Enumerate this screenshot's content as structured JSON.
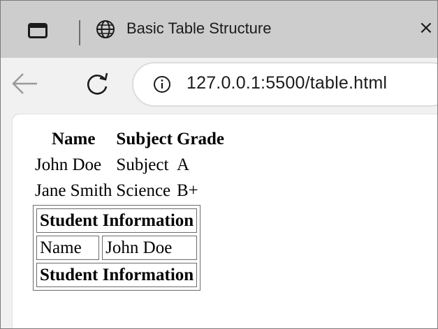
{
  "browser": {
    "tab_title": "Basic Table Structure",
    "tab_close": "×",
    "url": "127.0.0.1:5500/table.html",
    "icons": {
      "tab_actions": "tab-actions-icon",
      "site": "globe-icon",
      "back": "back-arrow-icon",
      "reload": "reload-icon",
      "info": "info-icon"
    }
  },
  "table1": {
    "headers": [
      "Name",
      "Subject",
      "Grade"
    ],
    "rows": [
      [
        "John Doe",
        "Subject",
        "A"
      ],
      [
        "Jane Smith",
        "Science",
        "B+"
      ]
    ]
  },
  "table2": {
    "header": "Student Information",
    "row": [
      "Name",
      "John Doe"
    ],
    "footer": "Student Information"
  }
}
